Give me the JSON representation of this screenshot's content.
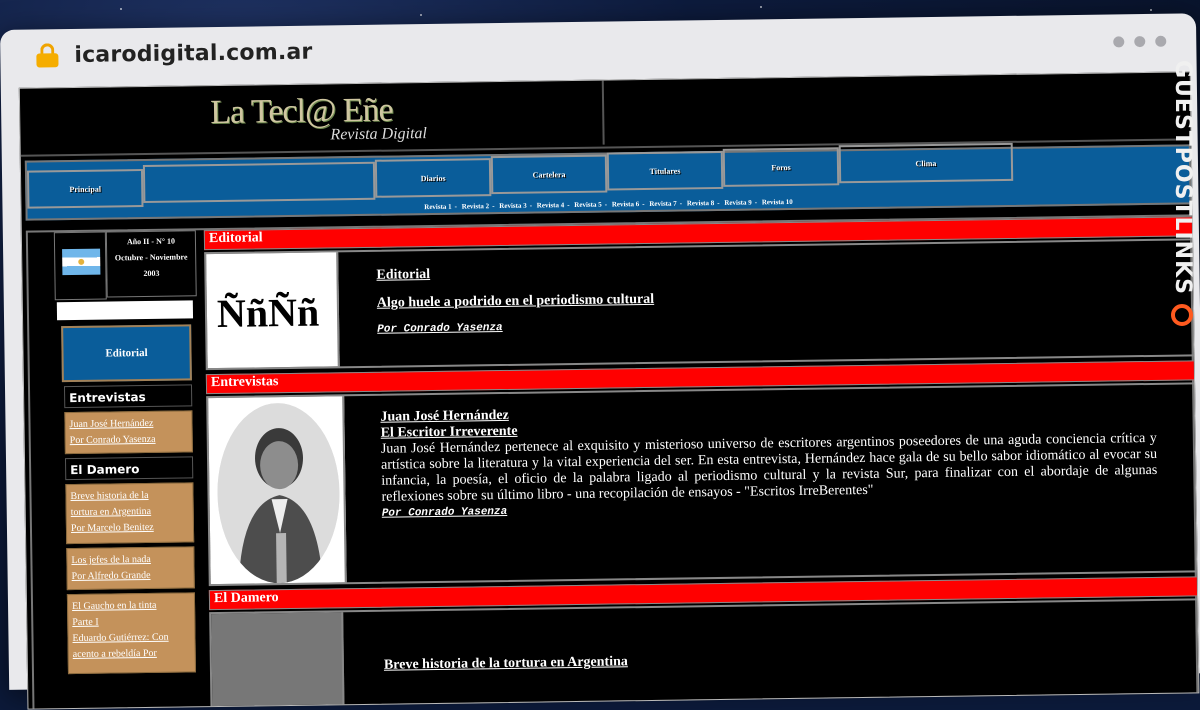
{
  "browser": {
    "url": "icarodigital.com.ar"
  },
  "site": {
    "logo_title": "La Tecl@ Eñe",
    "logo_sub": "Revista Digital"
  },
  "nav": {
    "items": [
      "Principal",
      "",
      "Diarios",
      "Cartelera",
      "Titulares",
      "Foros",
      "Clima"
    ],
    "revistas": [
      "Revista 1",
      "Revista 2",
      "Revista 3",
      "Revista 4",
      "Revista 5",
      "Revista 6",
      "Revista 7",
      "Revista 8",
      "Revista 9",
      "Revista 10"
    ]
  },
  "sidebar": {
    "issue_line1": "Año II - N° 10",
    "issue_line2": "Octubre - Noviembre",
    "issue_line3": "2003",
    "editorial_button": "Editorial",
    "entrevistas_head": "Entrevistas",
    "entrevistas_links": [
      "Juan José Hernández",
      "Por Conrado Yasenza"
    ],
    "damero_head": "El Damero",
    "damero_links": [
      [
        "Breve historia de la",
        "tortura en Argentina",
        "Por Marcelo Benitez"
      ],
      [
        "Los jefes de la nada",
        "Por Alfredo Grande"
      ],
      [
        "El Gaucho en la tinta",
        "Parte I",
        "Eduardo Gutiérrez: Con",
        "acento a rebeldía Por"
      ]
    ]
  },
  "content": {
    "editorial": {
      "section": "Editorial",
      "image_text": "ÑñÑñ",
      "title": "Editorial",
      "headline": "Algo huele a podrido en el periodismo cultural",
      "byline": "Por Conrado Yasenza"
    },
    "entrevistas": {
      "section": "Entrevistas",
      "name": "Juan José Hernández",
      "subtitle": "El Escritor Irreverente",
      "body": "Juan José Hernández pertenece al exquisito y misterioso universo de escritores argentinos poseedores de una aguda conciencia crítica y artística sobre la literatura y la vital experiencia del ser. En esta entrevista, Hernández hace gala de su bello sabor idiomático al evocar su infancia, la poesía, el oficio de la palabra ligado al periodismo cultural y la revista Sur, para finalizar con el abordaje de algunas reflexiones sobre su último libro - una recopilación de ensayos - \"Escritos IrreBerentes\"",
      "byline": "Por Conrado Yasenza"
    },
    "damero": {
      "section": "El Damero",
      "headline": "Breve historia de la tortura en Argentina"
    }
  },
  "watermark": {
    "text": "GUESTPOSTLINKS"
  }
}
